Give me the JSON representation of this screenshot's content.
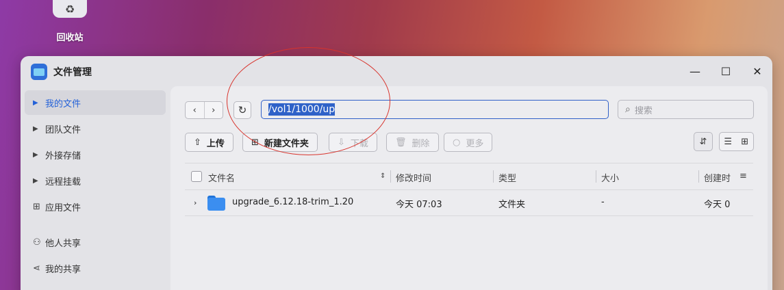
{
  "desktop": {
    "recycle_bin_label": "回收站"
  },
  "window": {
    "title": "文件管理",
    "controls": {
      "minimize": "—",
      "maximize": "☐",
      "close": "✕"
    }
  },
  "sidebar": {
    "items": [
      {
        "label": "我的文件",
        "icon": "triangle-right-icon",
        "active": true
      },
      {
        "label": "团队文件",
        "icon": "triangle-right-icon"
      },
      {
        "label": "外接存储",
        "icon": "triangle-right-icon"
      },
      {
        "label": "远程挂载",
        "icon": "triangle-right-icon"
      },
      {
        "label": "应用文件",
        "icon": "grid-icon"
      },
      {
        "label": "他人共享",
        "icon": "users-icon"
      },
      {
        "label": "我的共享",
        "icon": "share-icon"
      }
    ]
  },
  "address": {
    "path": "/vol1/1000/up",
    "search_placeholder": "搜索"
  },
  "toolbar": {
    "upload": "上传",
    "new_folder": "新建文件夹",
    "download": "下载",
    "delete": "删除",
    "more": "更多"
  },
  "table": {
    "columns": [
      "文件名",
      "修改时间",
      "类型",
      "大小",
      "创建时"
    ],
    "rows": [
      {
        "name": "upgrade_6.12.18-trim_1.20",
        "modified": "今天 07:03",
        "type": "文件夹",
        "size": "-",
        "created": "今天 0"
      }
    ]
  },
  "colors": {
    "accent": "#2461d8",
    "annotation": "#d8332c"
  }
}
